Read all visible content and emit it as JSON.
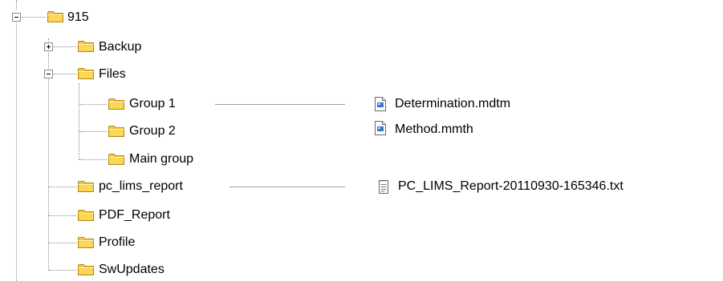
{
  "tree": {
    "root": {
      "label": "915"
    },
    "nodes": [
      {
        "label": "Backup",
        "expander": "plus"
      },
      {
        "label": "Files",
        "expander": "minus"
      },
      {
        "label": "Group 1"
      },
      {
        "label": "Group 2"
      },
      {
        "label": "Main group"
      },
      {
        "label": "pc_lims_report"
      },
      {
        "label": "PDF_Report"
      },
      {
        "label": "Profile"
      },
      {
        "label": "SwUpdates"
      }
    ]
  },
  "files": {
    "group1": [
      "Determination.mdtm",
      "Method.mmth"
    ],
    "pc_lims_report": [
      "PC_LIMS_Report-20110930-165346.txt"
    ]
  },
  "colors": {
    "folder_body": "#f5c842",
    "folder_outline": "#b48a16",
    "tree_line": "#8a8a8a",
    "connector": "#a0a0a0"
  },
  "icons": {
    "folder": "folder-icon",
    "method_file": "method-file-icon",
    "text_file": "text-file-icon",
    "expand": "expand-plus-icon",
    "collapse": "collapse-minus-icon"
  }
}
